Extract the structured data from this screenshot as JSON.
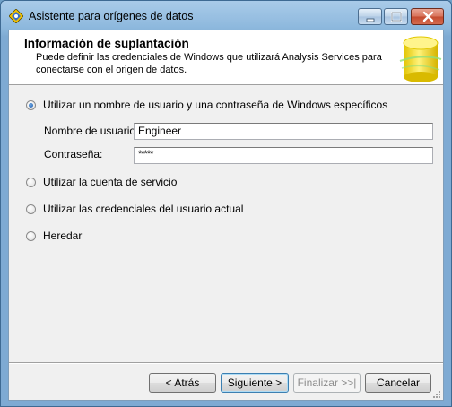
{
  "window": {
    "title": "Asistente para orígenes de datos"
  },
  "header": {
    "title": "Información de suplantación",
    "description": "Puede definir las credenciales de Windows que utilizará Analysis Services para conectarse con el origen de datos."
  },
  "options": [
    {
      "label": "Utilizar un nombre de usuario y una contraseña de Windows específicos",
      "selected": true
    },
    {
      "label": "Utilizar la cuenta de servicio",
      "selected": false
    },
    {
      "label": "Utilizar las credenciales del usuario actual",
      "selected": false
    },
    {
      "label": "Heredar",
      "selected": false
    }
  ],
  "fields": {
    "username_label": "Nombre de usuario:",
    "username_value": "Engineer",
    "password_label": "Contraseña:",
    "password_value": "*****"
  },
  "buttons": {
    "back": "< Atrás",
    "next": "Siguiente >",
    "finish": "Finalizar >>|",
    "cancel": "Cancelar"
  },
  "icons": {
    "app": "wizard-diamond-icon",
    "header_graphic": "database-cylinder-icon"
  }
}
